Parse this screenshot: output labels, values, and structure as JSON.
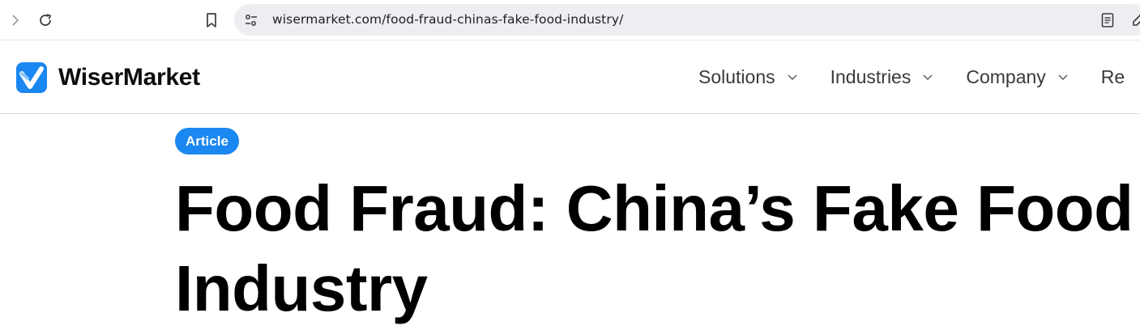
{
  "browser": {
    "url": "wisermarket.com/food-fraud-chinas-fake-food-industry/",
    "icons": {
      "forward": "chevron-right-icon",
      "reload": "reload-icon",
      "bookmark": "bookmark-icon",
      "site_info": "tune-icon",
      "reader": "reader-mode-icon",
      "edit": "edit-icon"
    }
  },
  "header": {
    "logo_text": "WiserMarket",
    "nav": [
      {
        "label": "Solutions"
      },
      {
        "label": "Industries"
      },
      {
        "label": "Company"
      },
      {
        "label": "Re"
      }
    ]
  },
  "article": {
    "category_badge": "Article",
    "title_line1": "Food Fraud: China’s Fake Food",
    "title_line2": "Industry"
  },
  "colors": {
    "brand_blue": "#1b87f0",
    "omnibox_bg": "#edeef2",
    "title_text": "#000000"
  }
}
